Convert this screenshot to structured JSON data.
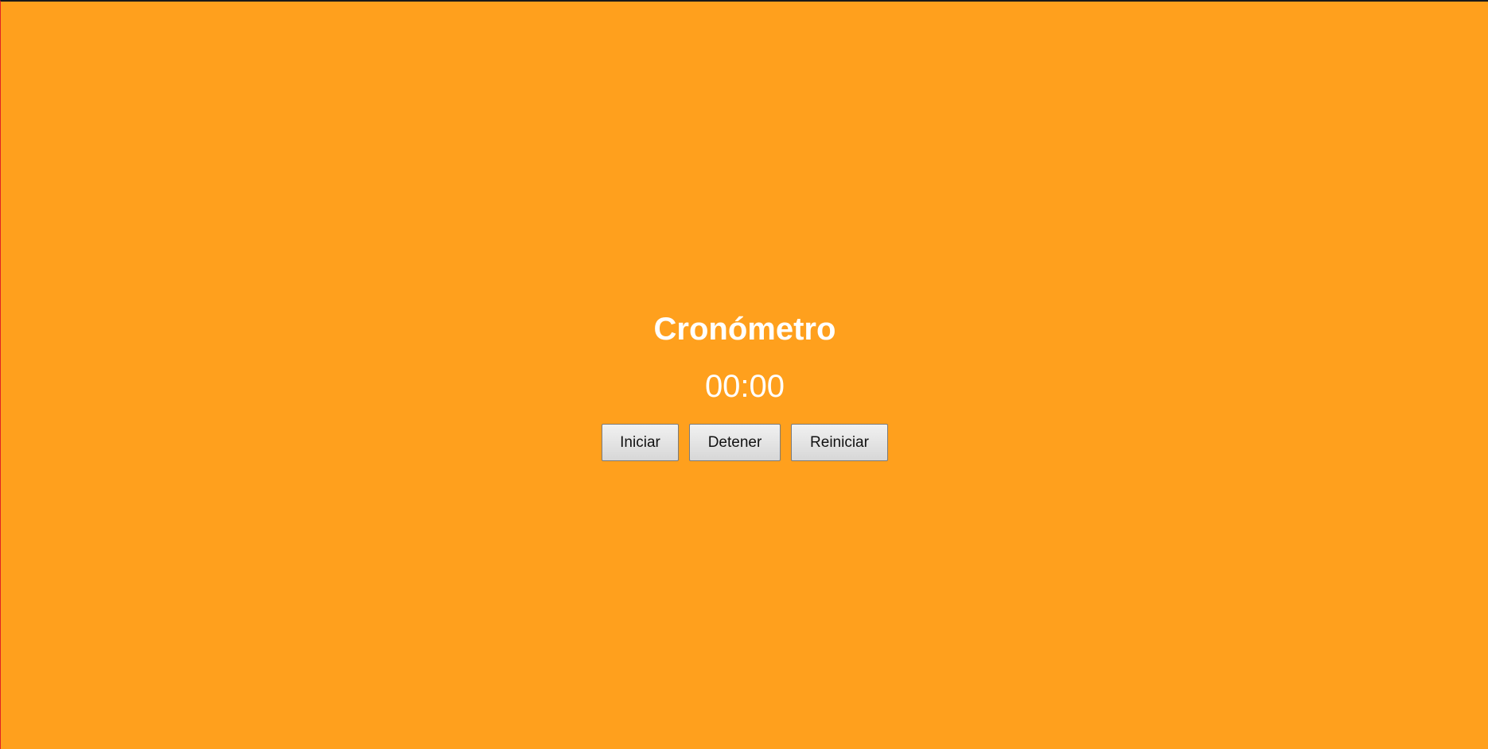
{
  "stopwatch": {
    "title": "Cronómetro",
    "time": "00:00",
    "buttons": {
      "start": "Iniciar",
      "stop": "Detener",
      "reset": "Reiniciar"
    }
  },
  "colors": {
    "background": "#ffa01d",
    "text": "#ffffff",
    "button_text": "#111111"
  }
}
